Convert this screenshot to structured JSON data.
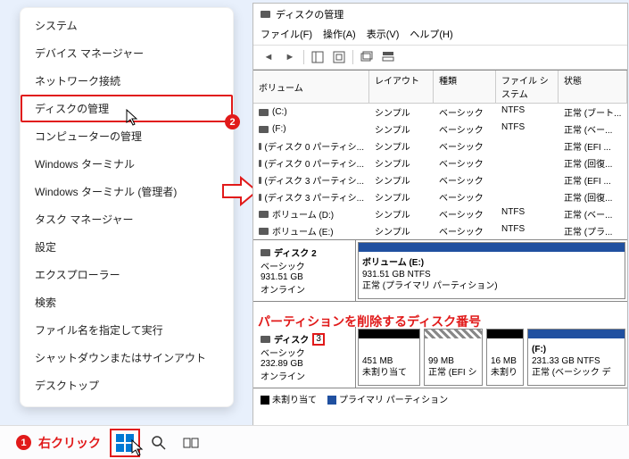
{
  "context_menu": {
    "items": [
      "システム",
      "デバイス マネージャー",
      "ネットワーク接続",
      "ディスクの管理",
      "コンピューターの管理",
      "Windows ターミナル",
      "Windows ターミナル (管理者)",
      "タスク マネージャー",
      "設定",
      "エクスプローラー",
      "検索",
      "ファイル名を指定して実行",
      "シャットダウンまたはサインアウト",
      "デスクトップ"
    ],
    "highlighted_index": 3,
    "badge2": "2"
  },
  "taskbar": {
    "badge1": "1",
    "right_click_label": "右クリック"
  },
  "dm": {
    "title": "ディスクの管理",
    "menu": {
      "file": "ファイル(F)",
      "action": "操作(A)",
      "view": "表示(V)",
      "help": "ヘルプ(H)"
    },
    "cols": {
      "vol": "ボリューム",
      "layout": "レイアウト",
      "type": "種類",
      "fs": "ファイル システム",
      "status": "状態"
    },
    "rows": [
      {
        "vol": "(C:)",
        "layout": "シンプル",
        "type": "ベーシック",
        "fs": "NTFS",
        "status": "正常 (ブート..."
      },
      {
        "vol": "(F:)",
        "layout": "シンプル",
        "type": "ベーシック",
        "fs": "NTFS",
        "status": "正常 (ベー..."
      },
      {
        "vol": "(ディスク 0 パーティシ...",
        "layout": "シンプル",
        "type": "ベーシック",
        "fs": "",
        "status": "正常 (EFI ..."
      },
      {
        "vol": "(ディスク 0 パーティシ...",
        "layout": "シンプル",
        "type": "ベーシック",
        "fs": "",
        "status": "正常 (回復..."
      },
      {
        "vol": "(ディスク 3 パーティシ...",
        "layout": "シンプル",
        "type": "ベーシック",
        "fs": "",
        "status": "正常 (EFI ..."
      },
      {
        "vol": "(ディスク 3 パーティシ...",
        "layout": "シンプル",
        "type": "ベーシック",
        "fs": "",
        "status": "正常 (回復..."
      },
      {
        "vol": "ボリューム (D:)",
        "layout": "シンプル",
        "type": "ベーシック",
        "fs": "NTFS",
        "status": "正常 (ベー..."
      },
      {
        "vol": "ボリューム (E:)",
        "layout": "シンプル",
        "type": "ベーシック",
        "fs": "NTFS",
        "status": "正常 (プラ..."
      }
    ],
    "disk2": {
      "name": "ディスク 2",
      "t": "ベーシック",
      "size": "931.51 GB",
      "state": "オンライン",
      "part": {
        "title": "ボリューム  (E:)",
        "line2": "931.51 GB NTFS",
        "line3": "正常 (プライマリ パーティション)"
      }
    },
    "annotation": "パーティションを削除するディスク番号",
    "disk3": {
      "name_a": "ディスク ",
      "name_b": "3",
      "t": "ベーシック",
      "size": "232.89 GB",
      "state": "オンライン",
      "p1": {
        "a": "451 MB",
        "b": "未割り当て"
      },
      "p2": {
        "a": "99 MB",
        "b": "正常 (EFI シ"
      },
      "p3": {
        "a": "16 MB",
        "b": "未割り"
      },
      "p4": {
        "a": "(F:)",
        "b": "231.33 GB NTFS",
        "c": "正常 (ベーシック デ"
      }
    },
    "legend": {
      "a": "未割り当て",
      "b": "プライマリ パーティション"
    }
  }
}
